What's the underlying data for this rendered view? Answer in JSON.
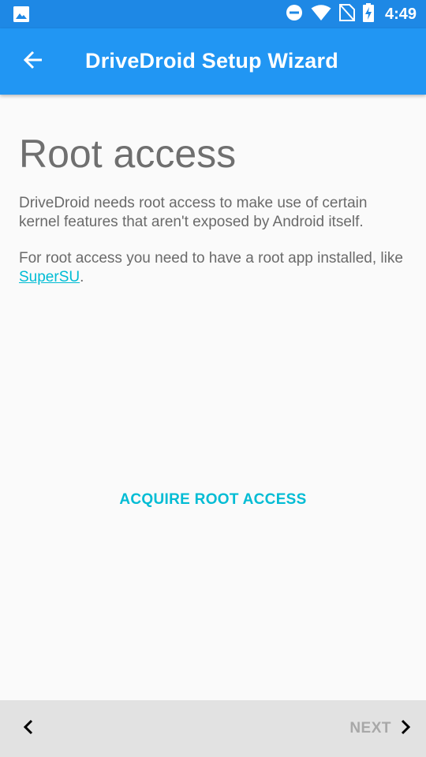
{
  "status_bar": {
    "time": "4:49",
    "icons": [
      "image-icon",
      "do-not-disturb-icon",
      "wifi-icon",
      "no-sim-icon",
      "battery-charging-icon"
    ]
  },
  "app_bar": {
    "title": "DriveDroid Setup Wizard",
    "back_icon": "arrow-back-icon"
  },
  "content": {
    "title": "Root access",
    "paragraph1": "DriveDroid needs root access to make use of certain kernel features that aren't exposed by Android itself.",
    "paragraph2_prefix": "For root access you need to have a root app installed, like ",
    "paragraph2_link": "SuperSU",
    "paragraph2_suffix": "."
  },
  "acquire_button": {
    "label": "ACQUIRE ROOT ACCESS"
  },
  "bottom_bar": {
    "prev_icon": "chevron-left-icon",
    "next_label": "NEXT",
    "next_icon": "chevron-right-icon"
  },
  "colors": {
    "status_bar": "#1e88e5",
    "app_bar": "#2196f3",
    "accent": "#00bcd4",
    "background": "#fafafa",
    "bottom_bar": "#e2e2e2",
    "disabled_text": "#a8a8a8"
  }
}
